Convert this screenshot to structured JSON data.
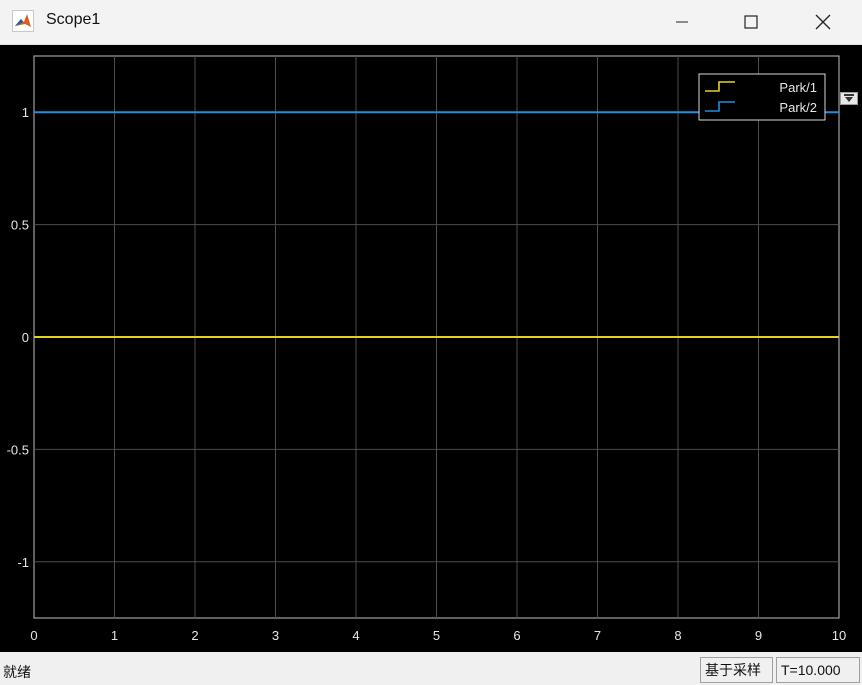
{
  "window": {
    "title": "Scope1",
    "app_icon": "matlab-icon"
  },
  "status": {
    "left_text": "就绪",
    "sampling_text": "基于采样",
    "time_text": "T=10.000"
  },
  "chart_data": {
    "type": "line",
    "xlim": [
      0,
      10
    ],
    "ylim": [
      -1.25,
      1.25
    ],
    "x_ticks": [
      "0",
      "1",
      "2",
      "3",
      "4",
      "5",
      "6",
      "7",
      "8",
      "9",
      "10"
    ],
    "y_ticks": [
      {
        "value": 1,
        "label": "1"
      },
      {
        "value": 0.5,
        "label": "0.5"
      },
      {
        "value": 0,
        "label": "0"
      },
      {
        "value": -0.5,
        "label": "-0.5"
      },
      {
        "value": -1,
        "label": "-1"
      }
    ],
    "grid": true,
    "legend_position": "top-right",
    "series": [
      {
        "name": "Park/1",
        "color": "#e6d21e",
        "x": [
          0,
          10
        ],
        "y": [
          0,
          0
        ]
      },
      {
        "name": "Park/2",
        "color": "#1f8fe0",
        "x": [
          0,
          10
        ],
        "y": [
          1,
          1
        ]
      }
    ]
  }
}
